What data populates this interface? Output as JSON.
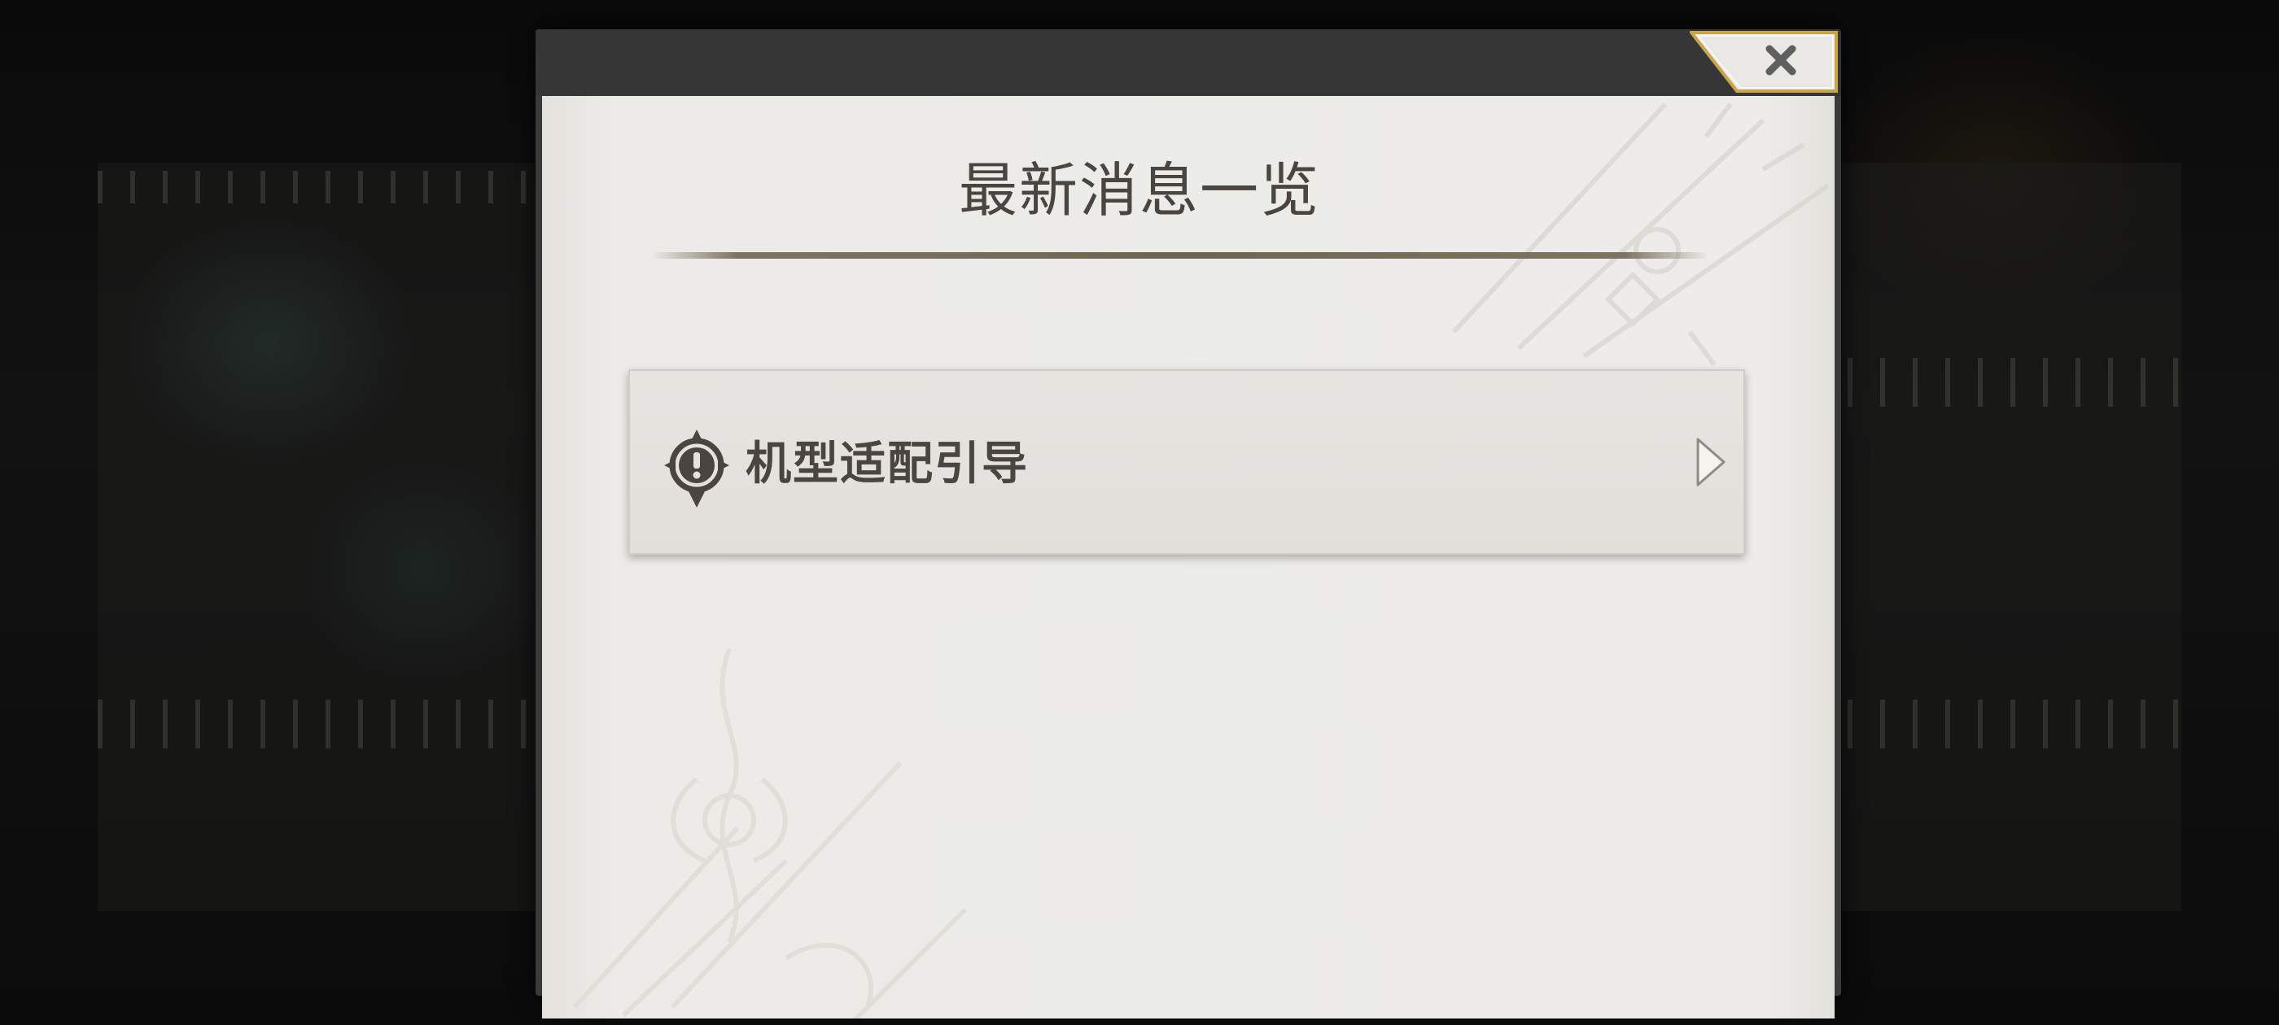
{
  "dialog": {
    "title": "最新消息一览",
    "close_icon": "close-icon"
  },
  "news_list": {
    "items": [
      {
        "label": "机型适配引导",
        "icon": "alert-compass-icon",
        "arrow_icon": "chevron-right-icon"
      }
    ]
  },
  "colors": {
    "panel_background": "#edecea",
    "title_text": "#4a4540",
    "frame_dark": "#363636",
    "close_accent_gold": "#c9a54a"
  }
}
